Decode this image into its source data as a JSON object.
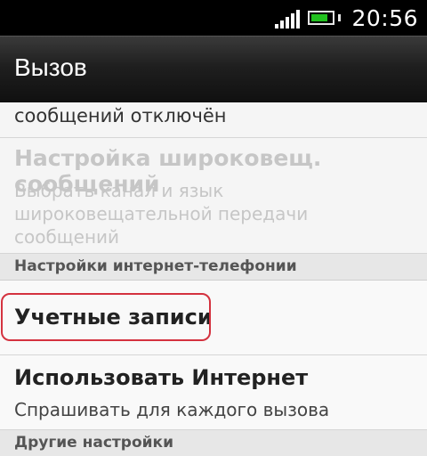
{
  "status_bar": {
    "time": "20:56",
    "signal_icon": "signal-bars-icon",
    "battery_icon": "battery-icon",
    "battery_color": "#22c11f"
  },
  "title_bar": {
    "title": "Вызов"
  },
  "list": {
    "cut_item_subtitle": "сообщений отключён",
    "broadcast_settings": {
      "title": "Настройка широковещ. сообщений",
      "subtitle": "Выбрать канал и язык широковещательной передачи сообщений",
      "enabled": false
    },
    "section_internet_calls": "Настройки интернет-телефонии",
    "accounts": {
      "title": "Учетные записи",
      "highlight_color": "#d4323f"
    },
    "use_internet": {
      "title": "Использовать Интернет",
      "subtitle": "Спрашивать для каждого вызова"
    },
    "section_other": "Другие настройки"
  }
}
